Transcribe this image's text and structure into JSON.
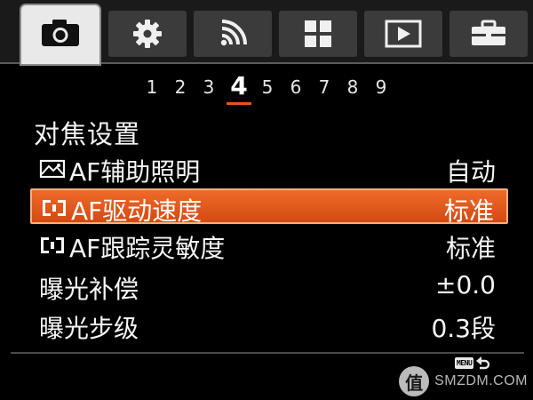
{
  "tabs": [
    {
      "icon": "camera-icon",
      "active": true
    },
    {
      "icon": "gear-icon",
      "active": false
    },
    {
      "icon": "wireless-icon",
      "active": false
    },
    {
      "icon": "grid-icon",
      "active": false
    },
    {
      "icon": "play-icon",
      "active": false
    },
    {
      "icon": "toolbox-icon",
      "active": false
    }
  ],
  "pages": [
    "1",
    "2",
    "3",
    "4",
    "5",
    "6",
    "7",
    "8",
    "9"
  ],
  "active_page": "4",
  "section_title": "对焦设置",
  "menu": {
    "items": [
      {
        "label": "AF辅助照明",
        "value": "自动",
        "icon": "af-illuminator-icon"
      },
      {
        "label": "AF驱动速度",
        "value": "标准",
        "icon": "af-frame-icon",
        "selected": true
      },
      {
        "label": " AF跟踪灵敏度",
        "value": "标准",
        "icon": "af-frame-icon"
      },
      {
        "label": "曝光补偿",
        "value": "±0.0"
      },
      {
        "label": "曝光步级",
        "value": "0.3段"
      }
    ]
  },
  "footer": {
    "menu_label": "MENU",
    "watermark_glyph": "值",
    "watermark_text": "SMZDM.COM"
  },
  "colors": {
    "accent": "#e2551e",
    "selected_bg": "#e35a1b",
    "tab_active": "#e9e9e9",
    "tab_inactive": "#3b3b3b"
  }
}
